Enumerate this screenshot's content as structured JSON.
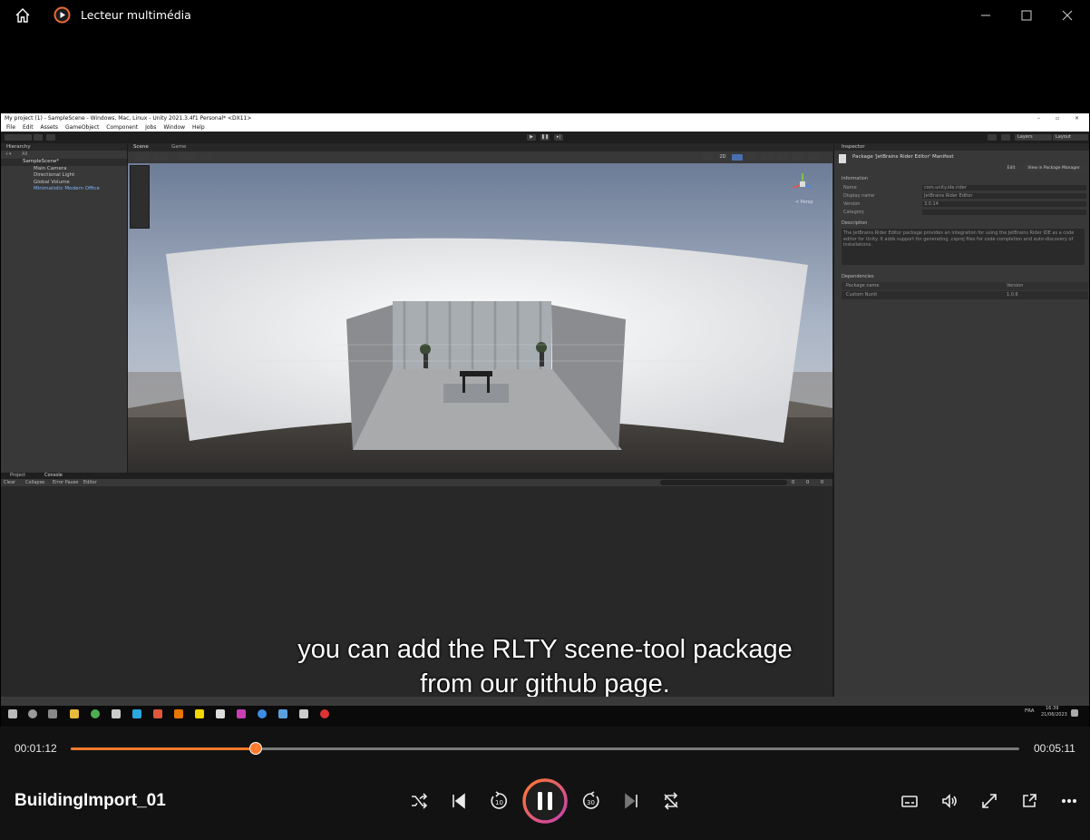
{
  "window": {
    "app_title": "Lecteur multimédia"
  },
  "video": {
    "file_name": "BuildingImport_01",
    "elapsed": "00:01:12",
    "duration": "00:05:11",
    "progress_fraction": 0.195,
    "subtitle_line1": "you can add the RLTY scene-tool package",
    "subtitle_line2": "from our github page."
  },
  "unity": {
    "title": "My project (1) - SampleScene - Windows, Mac, Linux - Unity 2021.3.4f1 Personal* <DX11>",
    "menu": [
      "File",
      "Edit",
      "Assets",
      "GameObject",
      "Component",
      "Jobs",
      "Window",
      "Help"
    ],
    "hierarchy_tab": "Hierarchy",
    "hierarchy_search": "All",
    "hierarchy_items": [
      "SampleScene*",
      "Main Camera",
      "Directional Light",
      "Global Volume",
      "Minimalistic Modern Office"
    ],
    "scene_tabs": [
      "Scene",
      "Game"
    ],
    "gizmo_label": "< Persp",
    "layers_label": "Layers",
    "layout_label": "Layout",
    "inspector_tab": "Inspector",
    "inspector_title": "Package 'JetBrains Rider Editor' Manifest",
    "inspector_edit": "Edit",
    "inspector_view": "View in Package Manager",
    "info_header": "Information",
    "info_rows": [
      {
        "label": "Name",
        "value": "com.unity.ide.rider"
      },
      {
        "label": "Display name",
        "value": "JetBrains Rider Editor"
      },
      {
        "label": "Version",
        "value": "3.0.14"
      },
      {
        "label": "Category",
        "value": ""
      }
    ],
    "description_header": "Description",
    "description_text": "The JetBrains Rider Editor package provides an integration for using the JetBrains Rider IDE as a code editor for Unity. It adds support for generating .csproj files for code completion and auto-discovery of installations.",
    "dependencies_header": "Dependencies",
    "dep_columns": [
      "Package name",
      "Version"
    ],
    "dep_rows": [
      {
        "name": "Custom Nunit",
        "version": "1.0.6"
      }
    ],
    "console_tabs": [
      "Project",
      "Console"
    ],
    "console_buttons": [
      "Clear",
      "Collapse",
      "Error Pause",
      "Editor"
    ],
    "console_counts": [
      "0",
      "0",
      "0"
    ]
  },
  "taskbar": {
    "lang": "FRA",
    "clock_time": "16:39",
    "clock_date": "21/06/2023"
  },
  "colors": {
    "accent": "#ff7a2e",
    "accent_ring": "#c83fb4"
  }
}
